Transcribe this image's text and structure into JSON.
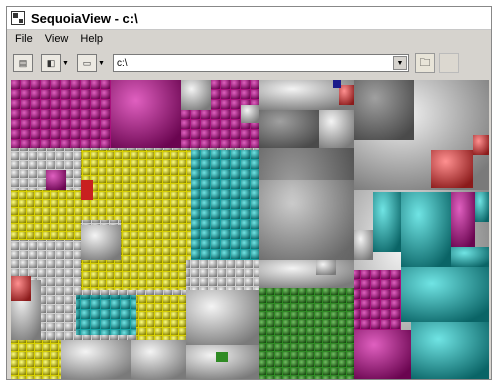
{
  "window": {
    "title": "SequoiaView - c:\\"
  },
  "menu": [
    {
      "label": "File"
    },
    {
      "label": "View"
    },
    {
      "label": "Help"
    }
  ],
  "toolbar": {
    "path_value": "c:\\"
  },
  "colors": {
    "magenta": "#a8107c",
    "yellow": "#d8d000",
    "cyan": "#17a0a2",
    "red": "#c83a3a",
    "green": "#2f8b24",
    "gray": "#b0b0b0"
  },
  "treemap_blocks": [
    {
      "color": "magenta"
    },
    {
      "color": "magenta"
    },
    {
      "color": "magenta"
    },
    {
      "color": "gray"
    },
    {
      "color": "gray"
    },
    {
      "color": "yellow"
    },
    {
      "color": "cyan"
    },
    {
      "color": "red"
    },
    {
      "color": "green"
    },
    {
      "color": "cyan"
    },
    {
      "color": "magenta"
    },
    {
      "color": "gray"
    }
  ]
}
